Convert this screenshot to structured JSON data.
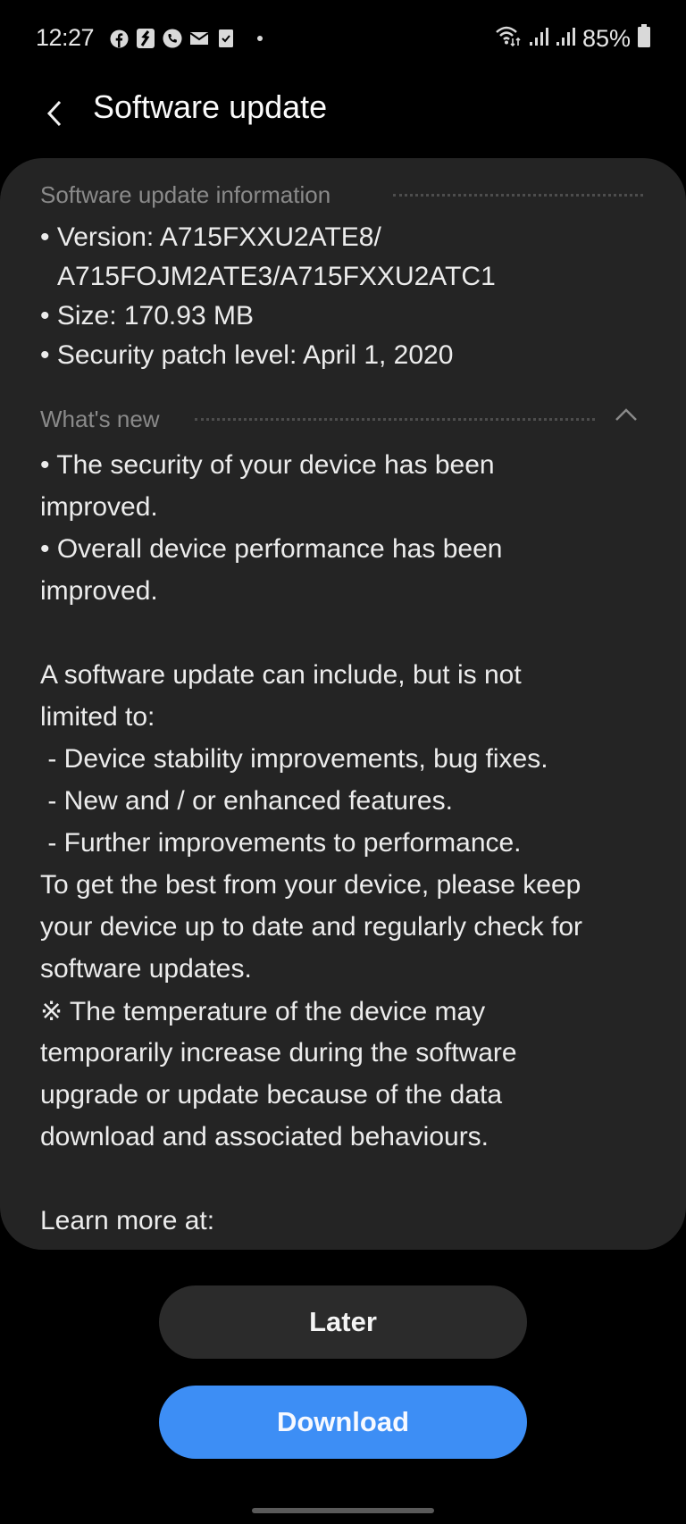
{
  "status_bar": {
    "time": "12:27",
    "notification_icons": [
      "facebook-icon",
      "sketch-app-icon",
      "phone-call-icon",
      "mail-icon",
      "clipboard-check-icon",
      "more-dot-icon"
    ],
    "system_icons": [
      "wifi-icon",
      "signal-icon-1",
      "signal-icon-2"
    ],
    "battery_percent": "85%",
    "battery_level": 0.85
  },
  "header": {
    "back_icon": "chevron-left-icon",
    "title": "Software update"
  },
  "info_section": {
    "heading": "Software update information",
    "version_line1": "• Version: A715FXXU2ATE8/",
    "version_line2": "A715FOJM2ATE3/A715FXXU2ATC1",
    "size": "• Size: 170.93 MB",
    "security_patch": "• Security patch level: April 1, 2020"
  },
  "whats_new": {
    "heading": "What's new",
    "collapse_icon": "chevron-up-icon",
    "lines": [
      "• The security of your device has been",
      "improved.",
      "• Overall device performance has been",
      "improved.",
      "",
      "A software update can include, but is not",
      "limited to:",
      " - Device stability improvements, bug fixes.",
      " - New and / or enhanced features.",
      " - Further improvements to performance.",
      "To get the best from your device, please keep",
      "your device up to date and regularly check for",
      "software updates.",
      "※ The temperature of the device may",
      "temporarily increase during the software",
      "upgrade or update because of the data",
      "download and associated behaviours.",
      "",
      "Learn more at:"
    ]
  },
  "buttons": {
    "later": "Later",
    "download": "Download"
  },
  "colors": {
    "accent": "#3d8ef5",
    "card_bg": "#242424",
    "background": "#000000"
  }
}
